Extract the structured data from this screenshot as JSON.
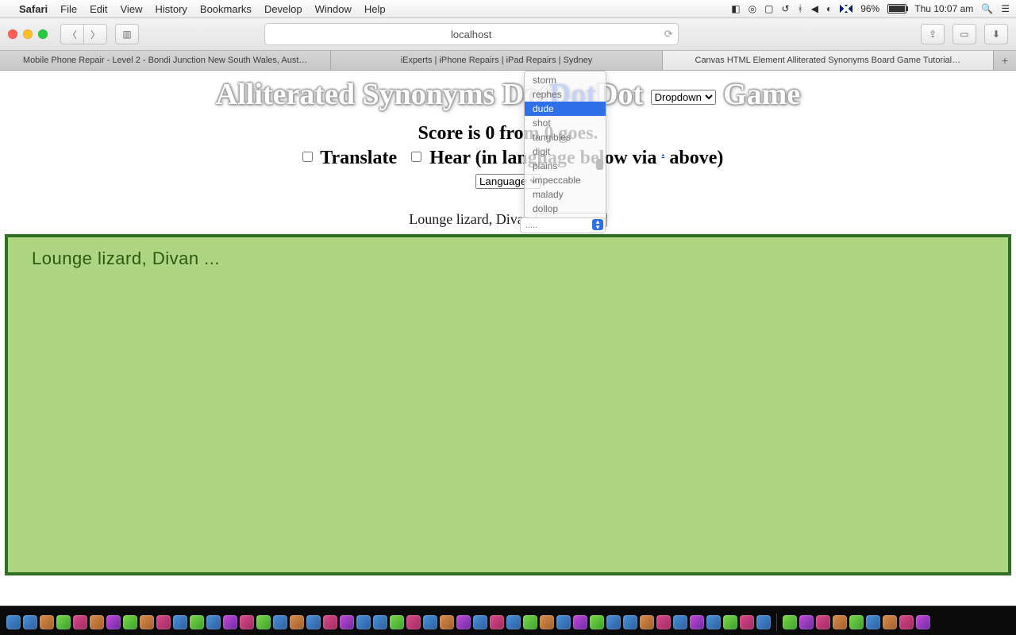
{
  "menubar": {
    "app": "Safari",
    "items": [
      "File",
      "Edit",
      "View",
      "History",
      "Bookmarks",
      "Develop",
      "Window",
      "Help"
    ],
    "battery_pct": "96%",
    "clock": "Thu 10:07 am"
  },
  "toolbar": {
    "address": "localhost"
  },
  "tabs": {
    "items": [
      "Mobile Phone Repair - Level 2 - Bondi Junction New South Wales, Aust…",
      "iExperts | iPhone Repairs | iPad Repairs | Sydney",
      "Canvas HTML Element Alliterated Synonyms Board Game Tutorial…"
    ],
    "active_index": 2
  },
  "page": {
    "title_prefix": "Alliterated Synonyms Dot",
    "title_link": "Dot",
    "title_mid": "Dot",
    "title_dropdown": "Dropdown",
    "title_suffix": " Game",
    "score_line": "Score is 0 from 0 goes.",
    "translate_label": "Translate",
    "hear_label": "Hear (in language below via ",
    "hear_dot": ".",
    "hear_label_end": " above)",
    "language_select": "Language",
    "prompt_text": "Lounge lizard, Divan",
    "answer_select_label": ".....",
    "board_text": "Lounge lizard, Divan ..."
  },
  "answer_dropdown": {
    "options": [
      "storm",
      "rephes",
      "dude",
      "shot",
      "tangibles",
      "digit",
      "plains",
      "impeccable",
      "malady",
      "dollop"
    ],
    "highlight_index": 2
  }
}
